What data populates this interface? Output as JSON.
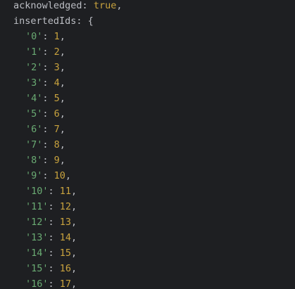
{
  "colors": {
    "background": "#1e1f22",
    "text": "#bcbec4",
    "string": "#6aab73",
    "number": "#c9a33e",
    "keyword": "#c9a33e"
  },
  "output": {
    "acknowledged_key": "acknowledged",
    "acknowledged_value": "true",
    "inserted_ids_key": "insertedIds",
    "open_brace": "{",
    "entries": [
      {
        "key": "'0'",
        "value": "1"
      },
      {
        "key": "'1'",
        "value": "2"
      },
      {
        "key": "'2'",
        "value": "3"
      },
      {
        "key": "'3'",
        "value": "4"
      },
      {
        "key": "'4'",
        "value": "5"
      },
      {
        "key": "'5'",
        "value": "6"
      },
      {
        "key": "'6'",
        "value": "7"
      },
      {
        "key": "'7'",
        "value": "8"
      },
      {
        "key": "'8'",
        "value": "9"
      },
      {
        "key": "'9'",
        "value": "10"
      },
      {
        "key": "'10'",
        "value": "11"
      },
      {
        "key": "'11'",
        "value": "12"
      },
      {
        "key": "'12'",
        "value": "13"
      },
      {
        "key": "'13'",
        "value": "14"
      },
      {
        "key": "'14'",
        "value": "15"
      },
      {
        "key": "'15'",
        "value": "16"
      },
      {
        "key": "'16'",
        "value": "17"
      }
    ]
  }
}
